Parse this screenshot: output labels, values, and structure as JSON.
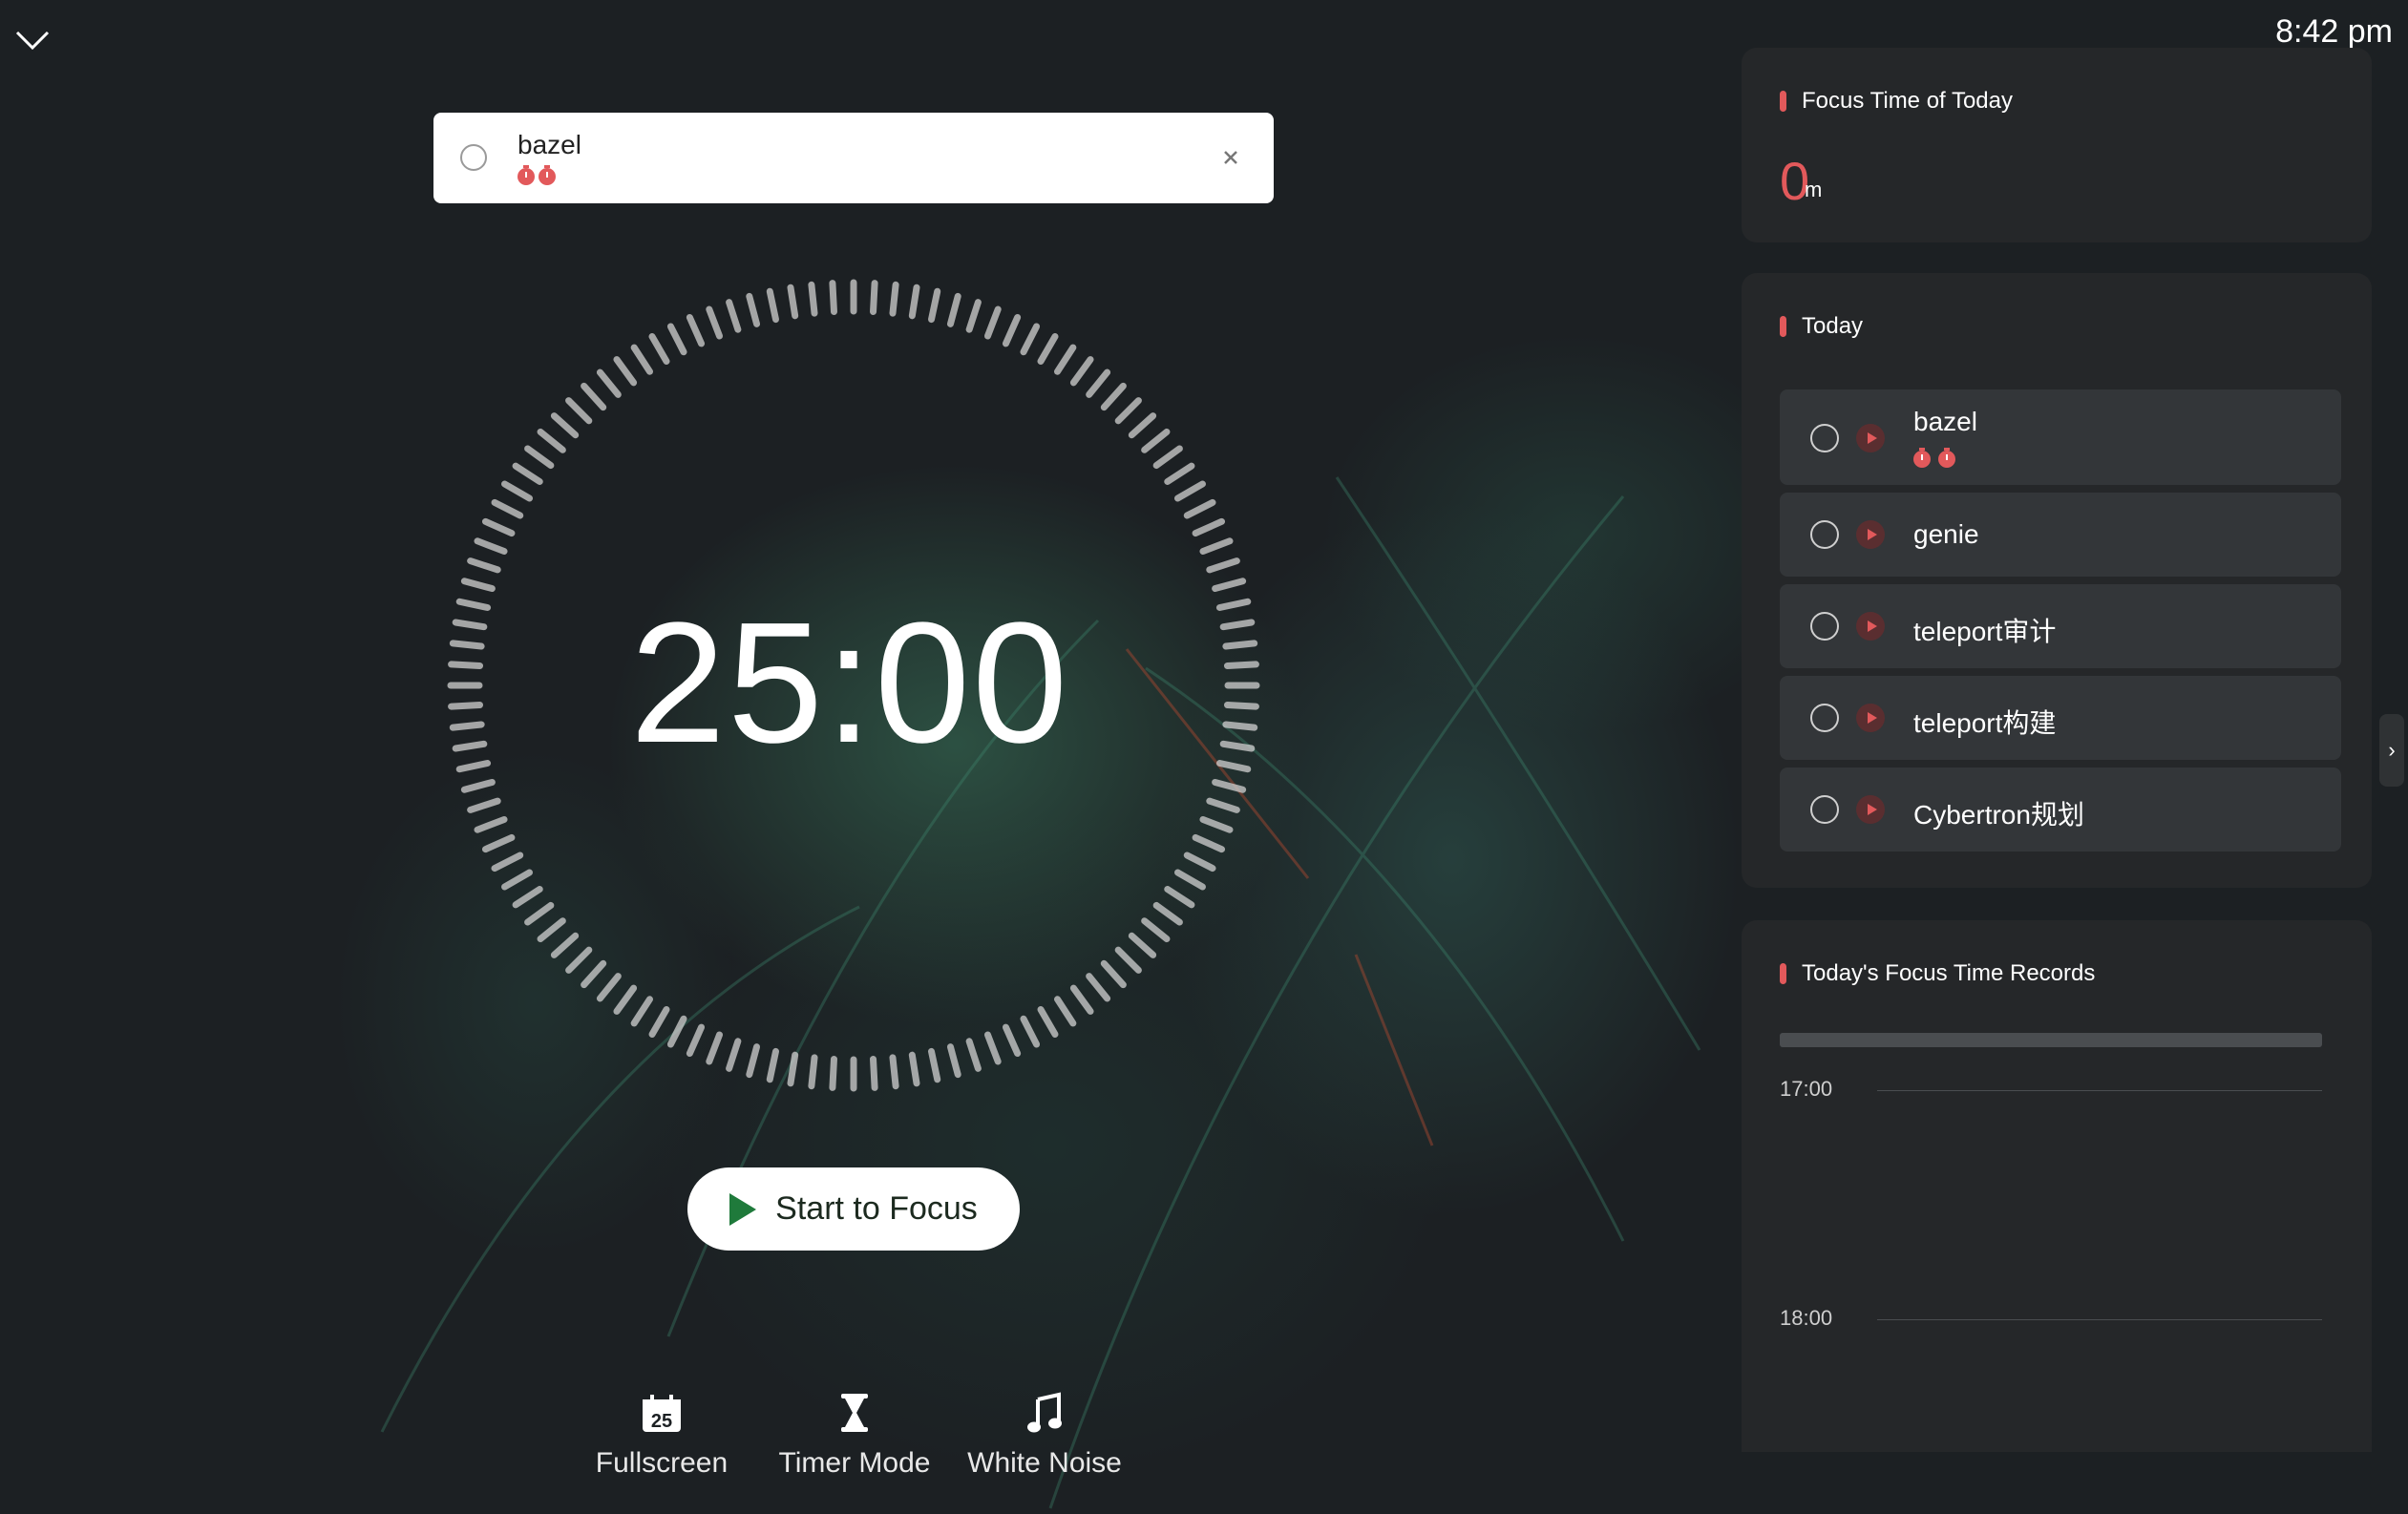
{
  "clock": "8:42 pm",
  "current_task": {
    "name": "bazel",
    "pomodoros": 2
  },
  "timer": {
    "display": "25:00"
  },
  "start_button": {
    "label": "Start to Focus"
  },
  "toolbar": {
    "fullscreen": {
      "label": "Fullscreen",
      "icon": "calendar-icon",
      "icon_text": "25"
    },
    "timer_mode": {
      "label": "Timer Mode",
      "icon": "hourglass-icon"
    },
    "white_noise": {
      "label": "White Noise",
      "icon": "music-note-icon"
    }
  },
  "panels": {
    "focus_today": {
      "title": "Focus Time of Today",
      "value": "0",
      "unit": "m"
    },
    "today": {
      "title": "Today",
      "tasks": [
        {
          "name": "bazel",
          "pomodoros": 2
        },
        {
          "name": "genie"
        },
        {
          "name": "teleport审计"
        },
        {
          "name": "teleport构建"
        },
        {
          "name": "Cybertron规划"
        }
      ]
    },
    "records": {
      "title": "Today's Focus Time Records",
      "times": [
        "17:00",
        "18:00"
      ]
    }
  },
  "side_tab": {
    "label": "›"
  },
  "colors": {
    "accent": "#e2595b",
    "play_green": "#1f7a3b",
    "panel_bg": "#25282a"
  }
}
